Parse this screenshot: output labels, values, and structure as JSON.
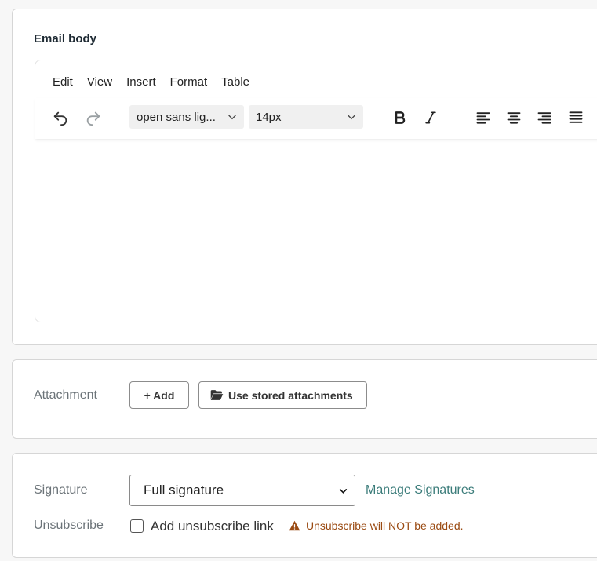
{
  "email_body": {
    "title": "Email body",
    "menu": [
      "Edit",
      "View",
      "Insert",
      "Format",
      "Table"
    ],
    "font_family_value": "open sans lig...",
    "font_size_value": "14px"
  },
  "attachment": {
    "label": "Attachment",
    "add_label": "+ Add",
    "stored_label": "Use stored attachments"
  },
  "signature": {
    "label": "Signature",
    "selected": "Full signature",
    "manage_link": "Manage Signatures"
  },
  "unsubscribe": {
    "label": "Unsubscribe",
    "checkbox_label": "Add unsubscribe link",
    "checked": false,
    "warning": "Unsubscribe will NOT be added."
  },
  "colors": {
    "link": "#3b7c7a",
    "warning": "#9a4a12"
  }
}
